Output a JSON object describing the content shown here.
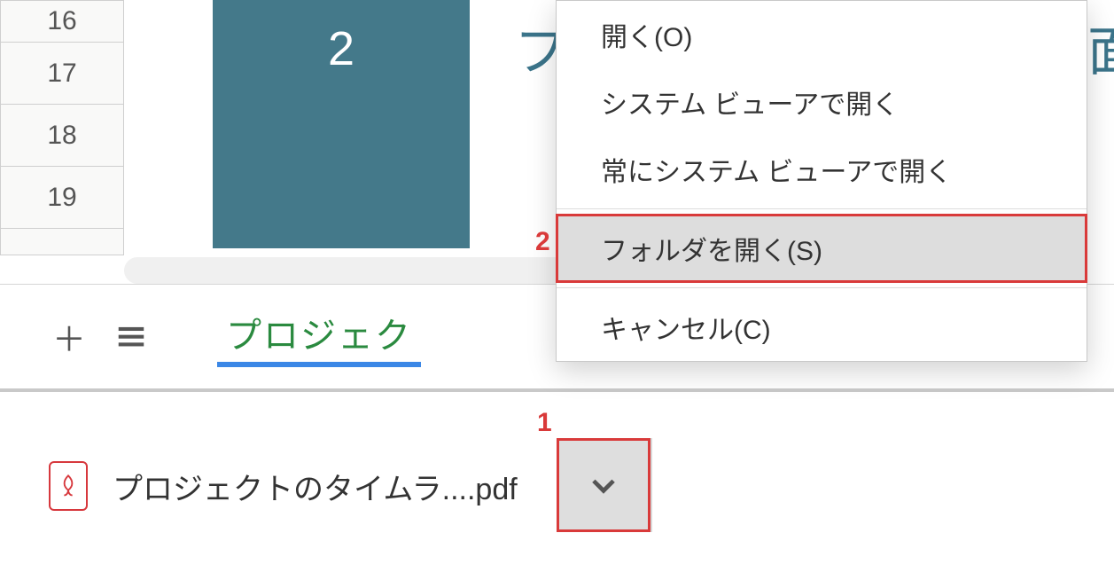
{
  "rows": [
    "16",
    "17",
    "18",
    "19"
  ],
  "cell_block_number": "2",
  "heading_left": "フ",
  "heading_right": "面",
  "sheet_tab_label": "プロジェク",
  "download": {
    "filename": "プロジェクトのタイムラ....pdf"
  },
  "menu": {
    "open": "開く(O)",
    "open_system": "システム ビューアで開く",
    "always_system": "常にシステム ビューアで開く",
    "show_folder": "フォルダを開く(S)",
    "cancel": "キャンセル(C)"
  },
  "callouts": {
    "one": "1",
    "two": "2"
  }
}
